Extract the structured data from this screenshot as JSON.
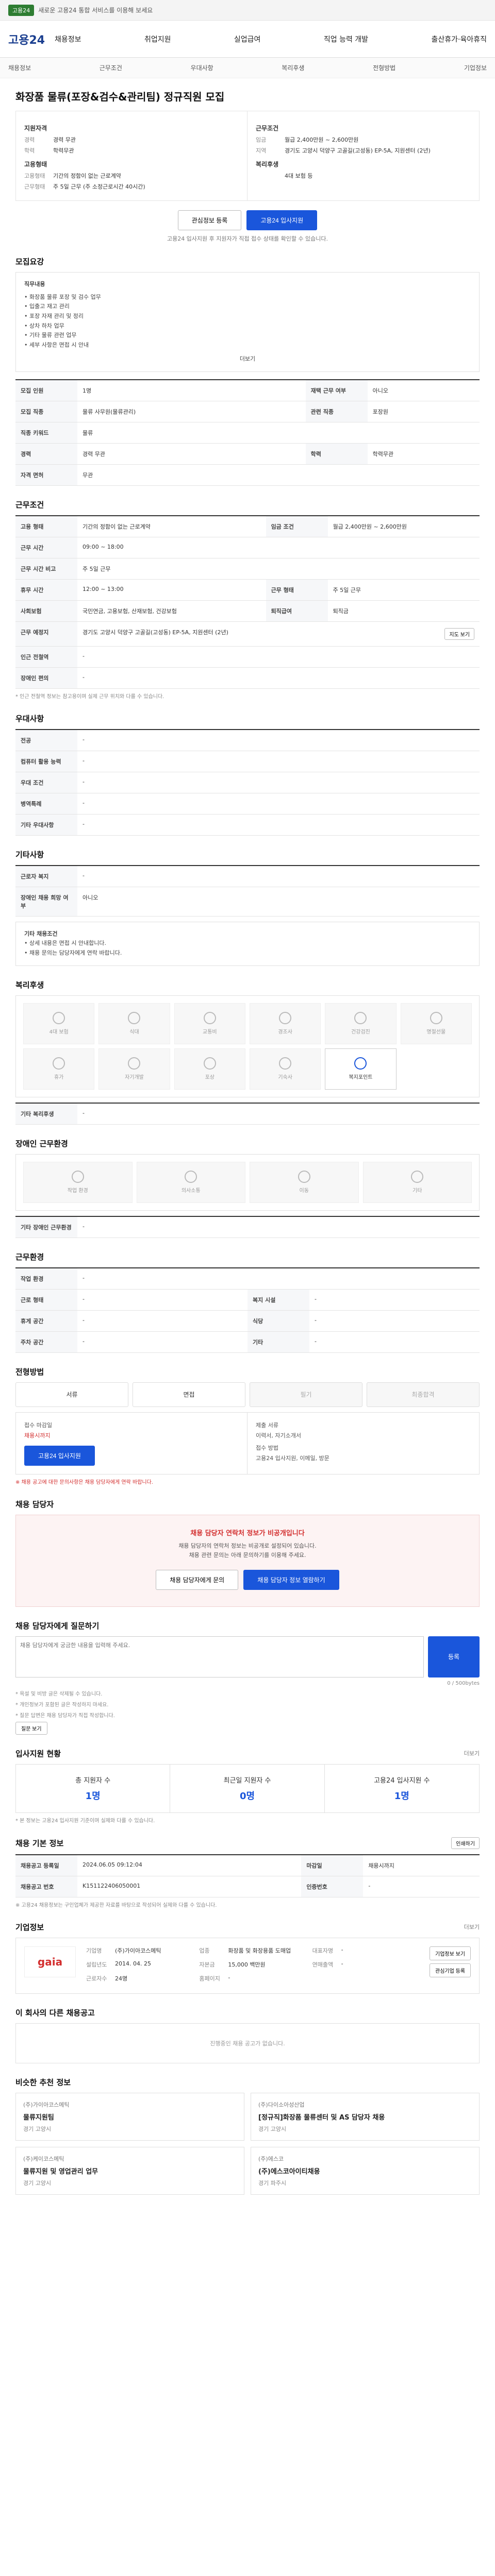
{
  "topbar": {
    "tag": "고용24",
    "message": "새로운 고용24 통합 서비스를 이용해 보세요"
  },
  "nav": {
    "logo": "고용24",
    "items": [
      "채용정보",
      "취업지원",
      "실업급여",
      "직업 능력 개발",
      "출산휴가·육아휴직"
    ]
  },
  "subnav": [
    "채용정보",
    "근무조건",
    "우대사항",
    "복리후생",
    "전형방법",
    "기업정보"
  ],
  "job": {
    "title": "화장품 물류(포장&검수&관리팀) 정규직원 모집",
    "left_title": "지원자격",
    "left_rows": [
      [
        "경력",
        "경력 무관"
      ],
      [
        "학력",
        "학력무관"
      ]
    ],
    "left_title2": "고용형태",
    "left_rows2": [
      [
        "고용형태",
        "기간의 정함이 없는 근로계약"
      ],
      [
        "근무형태",
        "주 5일 근무 (주 소정근로시간 40시간)"
      ]
    ],
    "right_title": "근무조건",
    "right_rows": [
      [
        "임금",
        "월급 2,400만원 ~ 2,600만원"
      ],
      [
        "지역",
        "경기도 고양시 덕양구 고골길(고성동) EP-5A, 지원센터 (2년)"
      ]
    ],
    "right_title2": "복리후생",
    "right_rows2": [
      [
        "",
        "4대 보험 등"
      ]
    ],
    "btn_like": "관심정보 등록",
    "btn_apply": "고용24 입사지원",
    "note": "고용24 입사지원 후 지원자가 직접 접수 상태를 확인할 수 있습니다."
  },
  "detail": {
    "title": "모집요강",
    "box_title": "직무내용",
    "box_lines": [
      "• 화장품 물류 포장 및 검수 업무",
      "• 입출고 재고 관리",
      "• 포장 자재 관리 및 정리",
      "• 상차 하차 업무",
      "• 기타 물류 관련 업무",
      "• 세부 사항은 면접 시 안내"
    ],
    "box_more": "더보기",
    "rows": [
      [
        "모집 인원",
        "1명",
        "재택 근무 여부",
        "아니오"
      ],
      [
        "모집 직종",
        "물류 사무원(물류관리)",
        "관련 직종",
        "포장원"
      ],
      [
        "직종 키워드",
        "물류",
        "",
        ""
      ],
      [
        "경력",
        "경력 무관",
        "학력",
        "학력무관"
      ],
      [
        "자격 면허",
        "무관",
        "",
        ""
      ]
    ]
  },
  "conditions": {
    "title": "근무조건",
    "rows": [
      [
        "고용 형태",
        "기간의 정함이 없는 근로계약",
        "임금 조건",
        "월급 2,400만원 ~ 2,600만원"
      ],
      [
        "근무 시간",
        "09:00 ~ 18:00",
        "",
        ""
      ],
      [
        "근무 시간 비고",
        "주 5일 근무",
        "",
        ""
      ],
      [
        "휴무 시간",
        "12:00 ~ 13:00",
        "근무 형태",
        "주 5일 근무"
      ],
      [
        "사회보험",
        "국민연금, 고용보험, 산재보험, 건강보험",
        "퇴직급여",
        "퇴직금"
      ],
      [
        "근무 예정지",
        "경기도 고양시 덕양구 고골길(고성동) EP-5A, 지원센터 (2년)",
        "",
        ""
      ],
      [
        "인근 전철역",
        "-",
        "",
        ""
      ],
      [
        "장애인 편의",
        "-",
        "",
        ""
      ]
    ],
    "map_btn": "지도 보기",
    "note": "* 인근 전철역 정보는 참고용이며 실제 근무 위치와 다를 수 있습니다."
  },
  "prefer": {
    "title": "우대사항",
    "rows": [
      [
        "전공",
        "-"
      ],
      [
        "컴퓨터 활용 능력",
        "-"
      ],
      [
        "우대 조건",
        "-"
      ],
      [
        "병역특례",
        "-"
      ],
      [
        "기타 우대사항",
        "-"
      ]
    ]
  },
  "etc": {
    "title": "기타사항",
    "rows": [
      [
        "근로자 복지",
        "-"
      ],
      [
        "장애인 채용 희망 여부",
        "아니오"
      ]
    ],
    "box_title": "기타 채용조건",
    "box_lines": [
      "• 상세 내용은 면접 시 안내합니다.",
      "• 채용 문의는 담당자에게 연락 바랍니다."
    ]
  },
  "welfare": {
    "title": "복리후생",
    "items": [
      "4대 보험",
      "식대",
      "교통비",
      "경조사",
      "건강검진",
      "명절선물",
      "휴가",
      "자기개발",
      "포상",
      "기숙사",
      "복지포인트"
    ],
    "note_title": "기타 복리후생",
    "note_value": "-"
  },
  "env": {
    "title": "장애인 근무환경",
    "items": [
      "작업 환경",
      "의사소통",
      "이동",
      "기타"
    ],
    "note_title": "기타 장애인 근무환경",
    "note_value": "-"
  },
  "worktype": {
    "title": "근무환경",
    "rows": [
      [
        "작업 환경",
        "-",
        "",
        ""
      ],
      [
        "근로 형태",
        "-",
        "복지 시설",
        "-"
      ],
      [
        "휴게 공간",
        "-",
        "식당",
        "-"
      ],
      [
        "주차 공간",
        "-",
        "기타",
        "-"
      ]
    ]
  },
  "method": {
    "title": "전형방법",
    "steps": [
      "서류",
      "면접",
      "필기",
      "최종합격"
    ],
    "apply_title": "접수 마감일",
    "apply_value": "채용시까지",
    "apply_btn": "고용24 입사지원",
    "docs_title": "제출 서류",
    "docs_value": "이력서, 자기소개서",
    "method_title": "접수 방법",
    "method_value": "고용24 입사지원, 이메일, 방문",
    "notice": "※ 채용 공고에 대한 문의사항은 채용 담당자에게 연락 바랍니다."
  },
  "contact": {
    "title": "채용 담당자",
    "alert_title": "채용 담당자 연락처 정보가 비공개입니다",
    "alert_line1": "채용 담당자의 연락처 정보는 비공개로 설정되어 있습니다.",
    "alert_line2": "채용 관련 문의는 아래 문의하기를 이용해 주세요.",
    "btn1": "채용 담당자에게 문의",
    "btn2": "채용 담당자 정보 열람하기"
  },
  "qa": {
    "title": "채용 담당자에게 질문하기",
    "placeholder": "채용 담당자에게 궁금한 내용을 입력해 주세요.",
    "counter": "0 / 500bytes",
    "btn": "등록",
    "notes": [
      "* 욕설 및 비방 글은 삭제될 수 있습니다.",
      "* 개인정보가 포함된 글은 작성하지 마세요.",
      "* 질문 답변은 채용 담당자가 직접 작성합니다."
    ],
    "more_btn": "질문 보기"
  },
  "stats": {
    "title": "입사지원 현황",
    "more": "더보기",
    "items": [
      [
        "총 지원자 수",
        "1명"
      ],
      [
        "최근일 지원자 수",
        "0명"
      ],
      [
        "고용24 입사지원 수",
        "1명"
      ]
    ],
    "note": "* 본 정보는 고용24 입사지원 기준이며 실제와 다를 수 있습니다."
  },
  "info": {
    "title": "채용 기본 정보",
    "rows": [
      [
        "채용공고 등록일",
        "2024.06.05 09:12:04",
        "마감일",
        "채용시까지"
      ],
      [
        "채용공고 번호",
        "K151122406050001",
        "인증번호",
        "-"
      ]
    ],
    "print_btn": "인쇄하기",
    "note": "※ 고용24 채용정보는 구인업체가 제공한 자료를 바탕으로 작성되어 실제와 다를 수 있습니다."
  },
  "company": {
    "title": "기업정보",
    "more": "더보기",
    "logo_text": "gaia",
    "fields": [
      [
        "기업명",
        "(주)가이아코스메틱"
      ],
      [
        "업종",
        "화장품 및 화장용품 도매업"
      ],
      [
        "대표자명",
        "-"
      ],
      [
        "설립년도",
        "2014. 04. 25"
      ],
      [
        "자본금",
        "15,000 백만원"
      ],
      [
        "연매출액",
        "-"
      ],
      [
        "근로자수",
        "24명"
      ],
      [
        "홈페이지",
        "-"
      ]
    ],
    "btn_detail": "기업정보 보기",
    "btn_follow": "관심기업 등록"
  },
  "similar": {
    "title": "이 회사의 다른 채용공고",
    "empty": "진행중인 채용 공고가 없습니다."
  },
  "recommend": {
    "title": "비슷한 추천 정보",
    "items": [
      {
        "company": "(주)가이아코스메틱",
        "job": "물류지원팀",
        "loc": "경기 고양시"
      },
      {
        "company": "(주)다이소아성산업",
        "job": "[정규직]화장품 물류센터 및 AS 담당자 채용",
        "loc": "경기 고양시"
      },
      {
        "company": "(주)케이코스메틱",
        "job": "물류지원 및 영업관리 업무",
        "loc": "경기 고양시"
      },
      {
        "company": "(주)에스코",
        "job": "(주)에스코아이티채용",
        "loc": "경기 파주시"
      }
    ]
  }
}
